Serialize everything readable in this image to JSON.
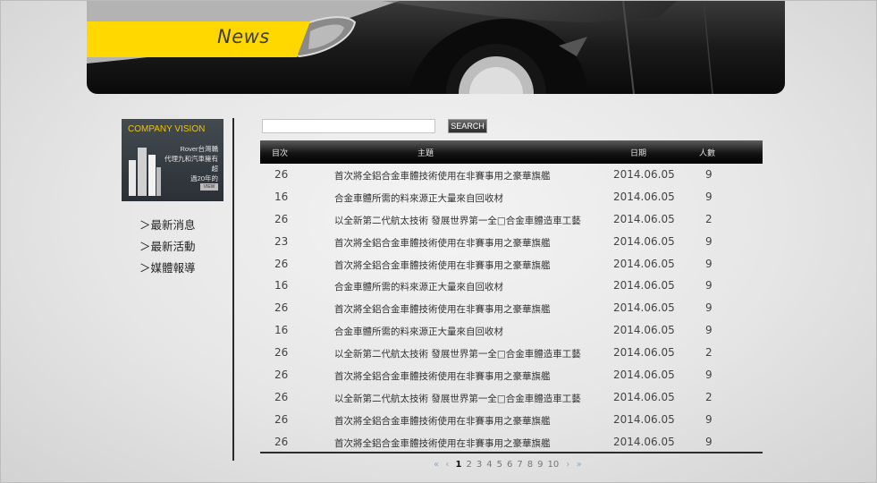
{
  "banner": {
    "title": "News"
  },
  "sidebar": {
    "vision_title": "COMPANY VISION",
    "vision_text": [
      "Rover台灣轎",
      "代理九和汽車擁有超",
      "過20年的"
    ],
    "vision_button": "VIEW",
    "nav": [
      {
        "label": "＞最新消息"
      },
      {
        "label": "＞最新活動"
      },
      {
        "label": "＞媒體報導"
      }
    ]
  },
  "search": {
    "value": "",
    "button_label": "SEARCH"
  },
  "table": {
    "headers": {
      "no": "目次",
      "subject": "主題",
      "date": "日期",
      "count": "人數"
    },
    "rows": [
      {
        "no": "26",
        "subject": "首次將全鋁合金車體技術使用在非賽事用之豪華旗艦",
        "date": "2014.06.05",
        "count": "9"
      },
      {
        "no": "16",
        "subject": "合金車體所需的料來源正大量來自回收材",
        "date": "2014.06.05",
        "count": "9"
      },
      {
        "no": "26",
        "subject": "以全新第二代航太技術  發展世界第一全□合金車體造車工藝",
        "date": "2014.06.05",
        "count": "2"
      },
      {
        "no": "23",
        "subject": "首次將全鋁合金車體技術使用在非賽事用之豪華旗艦",
        "date": "2014.06.05",
        "count": "9"
      },
      {
        "no": "26",
        "subject": "首次將全鋁合金車體技術使用在非賽事用之豪華旗艦",
        "date": "2014.06.05",
        "count": "9"
      },
      {
        "no": "16",
        "subject": "合金車體所需的料來源正大量來自回收材",
        "date": "2014.06.05",
        "count": "9"
      },
      {
        "no": "26",
        "subject": "首次將全鋁合金車體技術使用在非賽事用之豪華旗艦",
        "date": "2014.06.05",
        "count": "9"
      },
      {
        "no": "16",
        "subject": "合金車體所需的料來源正大量來自回收材",
        "date": "2014.06.05",
        "count": "9"
      },
      {
        "no": "26",
        "subject": "以全新第二代航太技術  發展世界第一全□合金車體造車工藝",
        "date": "2014.06.05",
        "count": "2"
      },
      {
        "no": "26",
        "subject": "首次將全鋁合金車體技術使用在非賽事用之豪華旗艦",
        "date": "2014.06.05",
        "count": "9"
      },
      {
        "no": "26",
        "subject": "以全新第二代航太技術  發展世界第一全□合金車體造車工藝",
        "date": "2014.06.05",
        "count": "2"
      },
      {
        "no": "26",
        "subject": "首次將全鋁合金車體技術使用在非賽事用之豪華旗艦",
        "date": "2014.06.05",
        "count": "9"
      },
      {
        "no": "26",
        "subject": "首次將全鋁合金車體技術使用在非賽事用之豪華旗艦",
        "date": "2014.06.05",
        "count": "9"
      }
    ]
  },
  "pager": {
    "first": "«",
    "prev": "‹",
    "pages": [
      "1",
      "2",
      "3",
      "4",
      "5",
      "6",
      "7",
      "8",
      "9",
      "10"
    ],
    "current": "1",
    "next": "›",
    "last": "»"
  },
  "colors": {
    "accent": "#ffd800",
    "header_bg": "#000000",
    "text": "#333333"
  }
}
